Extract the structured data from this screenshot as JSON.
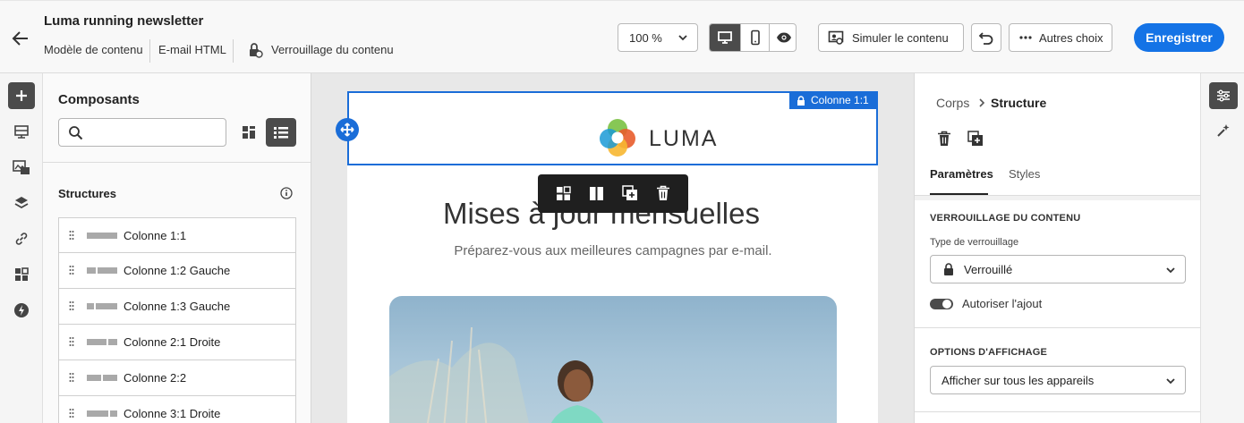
{
  "header": {
    "title": "Luma running newsletter",
    "meta": [
      "Modèle de contenu",
      "E-mail HTML"
    ],
    "lock_label": "Verrouillage du contenu",
    "zoom": "100 %",
    "simulate": "Simuler le contenu",
    "more": "Autres choix",
    "save": "Enregistrer"
  },
  "components": {
    "title": "Composants",
    "search_placeholder": "",
    "section": "Structures",
    "items": [
      "Colonne 1:1",
      "Colonne 1:2 Gauche",
      "Colonne 1:3 Gauche",
      "Colonne 2:1 Droite",
      "Colonne 2:2",
      "Colonne 3:1 Droite"
    ]
  },
  "canvas": {
    "selection_label": "Colonne 1:1",
    "logo_text": "LUMA",
    "headline": "Mises à jour mensuelles",
    "subline": "Préparez-vous aux meilleures campagnes par e-mail."
  },
  "props": {
    "breadcrumb_parent": "Corps",
    "breadcrumb_current": "Structure",
    "tabs": [
      "Paramètres",
      "Styles"
    ],
    "lock_section": "VERROUILLAGE DU CONTENU",
    "lock_type_label": "Type de verrouillage",
    "lock_type_value": "Verrouillé",
    "allow_add": "Autoriser l'ajout",
    "display_section": "OPTIONS D'AFFICHAGE",
    "display_value": "Afficher sur tous les appareils"
  },
  "colors": {
    "accent": "#1473e6",
    "selection": "#1a6dd8"
  }
}
